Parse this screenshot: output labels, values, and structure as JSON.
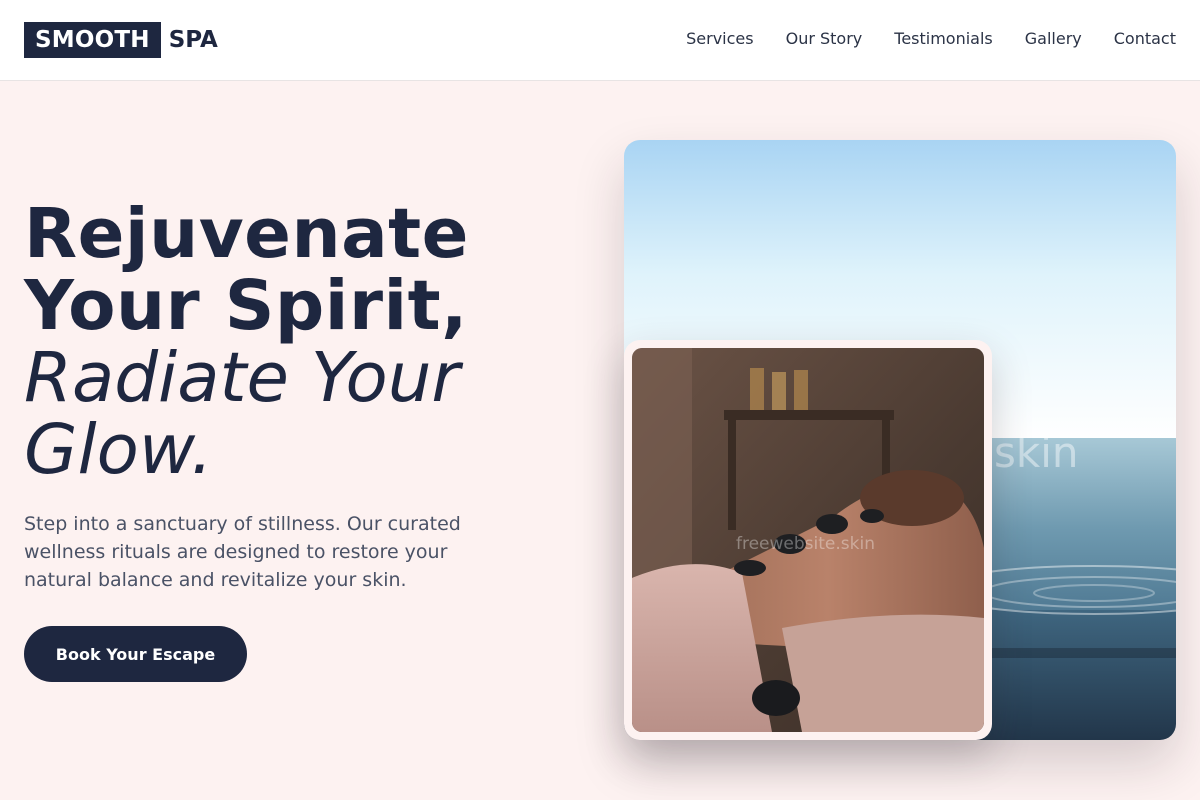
{
  "brand": {
    "logo_box": "SMOOTH",
    "logo_text": "SPA"
  },
  "nav": {
    "items": [
      "Services",
      "Our Story",
      "Testimonials",
      "Gallery",
      "Contact"
    ]
  },
  "hero": {
    "headline_line1": "Rejuvenate",
    "headline_line2": "Your Spirit,",
    "headline_line3": "Radiate Your",
    "headline_line4": "Glow.",
    "description": "Step into a sanctuary of stillness. Our curated wellness rituals are designed to restore your natural balance and revitalize your skin.",
    "cta_label": "Book Your Escape"
  },
  "images": {
    "large_image": "ocean-infinity-pool-photo",
    "small_image": "hot-stone-massage-photo",
    "watermark_large": "skin",
    "watermark_small": "freewebsite.skin"
  },
  "colors": {
    "primary": "#1e2740",
    "background": "#fdf2f1",
    "header_bg": "#ffffff"
  }
}
